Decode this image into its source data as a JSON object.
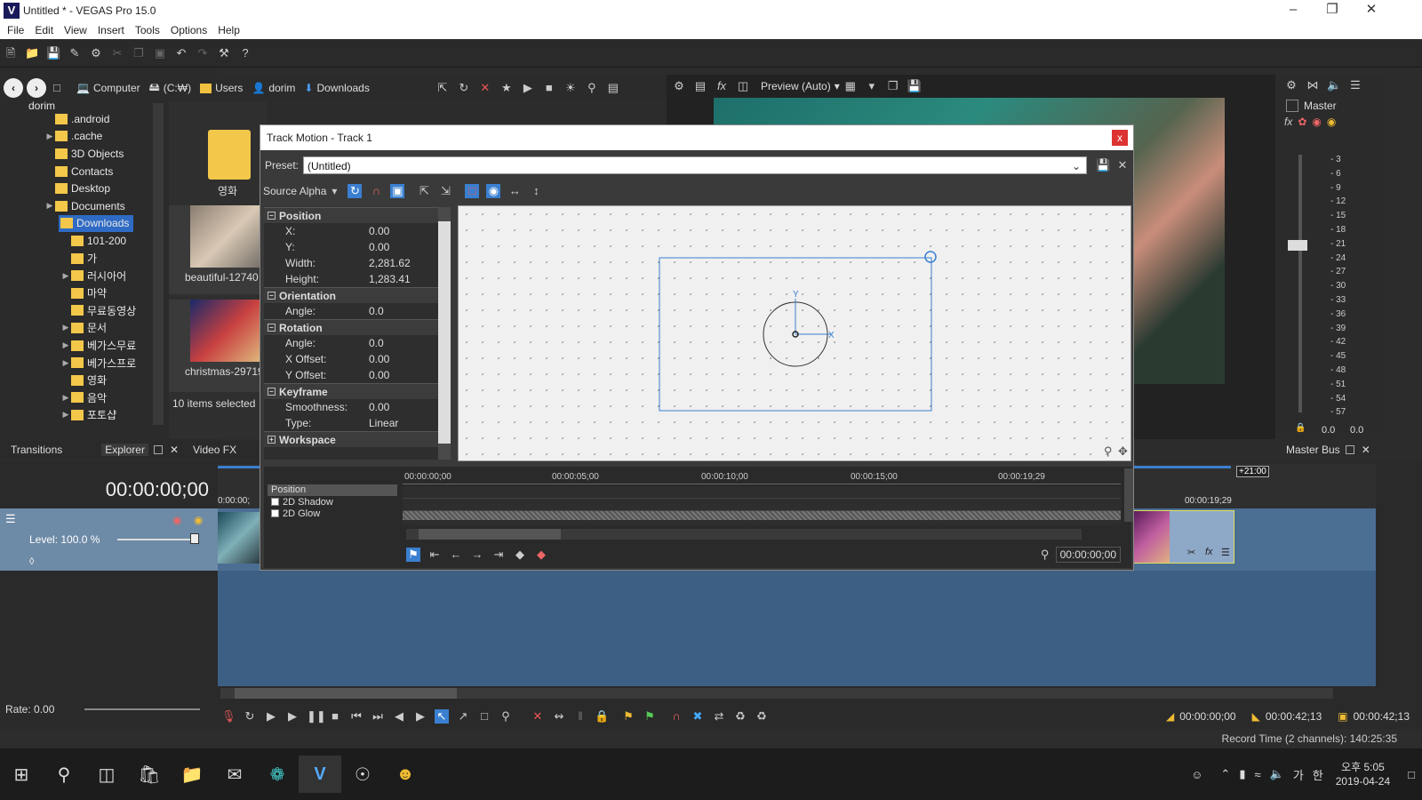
{
  "window": {
    "title": "Untitled * - VEGAS Pro 15.0",
    "logo": "V"
  },
  "menu": [
    "File",
    "Edit",
    "View",
    "Insert",
    "Tools",
    "Options",
    "Help"
  ],
  "nav": {
    "crumbs": [
      "Computer",
      "(C:₩)",
      "Users",
      "dorim",
      "Downloads"
    ]
  },
  "tree": {
    "root": "dorim",
    "items": [
      {
        "label": ".android",
        "arrow": ""
      },
      {
        "label": ".cache",
        "arrow": "▶"
      },
      {
        "label": "3D Objects",
        "arrow": ""
      },
      {
        "label": "Contacts",
        "arrow": ""
      },
      {
        "label": "Desktop",
        "arrow": ""
      },
      {
        "label": "Documents",
        "arrow": "▶"
      },
      {
        "label": "Downloads",
        "arrow": "▼",
        "selected": true
      },
      {
        "label": "101-200",
        "arrow": "",
        "indent": true
      },
      {
        "label": "가",
        "arrow": "",
        "indent": true
      },
      {
        "label": "러시아어",
        "arrow": "▶",
        "indent": true
      },
      {
        "label": "마약",
        "arrow": "",
        "indent": true
      },
      {
        "label": "무료동영상",
        "arrow": "",
        "indent": true
      },
      {
        "label": "문서",
        "arrow": "▶",
        "indent": true
      },
      {
        "label": "베가스무료",
        "arrow": "▶",
        "indent": true
      },
      {
        "label": "베가스프로",
        "arrow": "▶",
        "indent": true
      },
      {
        "label": "영화",
        "arrow": "",
        "indent": true
      },
      {
        "label": "음악",
        "arrow": "▶",
        "indent": true
      },
      {
        "label": "포토샵",
        "arrow": "▶",
        "indent": true
      }
    ]
  },
  "files": {
    "folder_label": "영화",
    "item1": "beautiful-12740",
    "item2": "christmas-29719",
    "selected": "10 items selected"
  },
  "tabs": {
    "transitions": "Transitions",
    "explorer": "Explorer",
    "videofx": "Video FX",
    "masterbus": "Master Bus"
  },
  "preview": {
    "mode": "Preview (Auto)"
  },
  "master": {
    "label": "Master",
    "db": [
      "3",
      "6",
      "9",
      "12",
      "15",
      "18",
      "21",
      "24",
      "27",
      "30",
      "33",
      "36",
      "39",
      "42",
      "45",
      "48",
      "51",
      "54",
      "57"
    ],
    "left": "0.0",
    "right": "0.0"
  },
  "dialog": {
    "title": "Track Motion - Track 1",
    "close": "x",
    "preset_label": "Preset:",
    "preset_value": "(Untitled)",
    "source_alpha": "Source Alpha",
    "sections": {
      "position": "Position",
      "orientation": "Orientation",
      "rotation": "Rotation",
      "keyframe": "Keyframe",
      "workspace": "Workspace"
    },
    "props": {
      "x_label": "X:",
      "x": "0.00",
      "y_label": "Y:",
      "y": "0.00",
      "w_label": "Width:",
      "w": "2,281.62",
      "h_label": "Height:",
      "h": "1,283.41",
      "o_angle_label": "Angle:",
      "o_angle": "0.0",
      "r_angle_label": "Angle:",
      "r_angle": "0.0",
      "xo_label": "X Offset:",
      "xo": "0.00",
      "yo_label": "Y Offset:",
      "yo": "0.00",
      "smooth_label": "Smoothness:",
      "smooth": "0.00",
      "type_label": "Type:",
      "type": "Linear"
    },
    "axis_y": "Y",
    "axis_x": "X",
    "kf_rows": [
      "Position",
      "2D Shadow",
      "2D Glow"
    ],
    "kf_ticks": [
      "00:00:00;00",
      "00:00:05;00",
      "00:00:10;00",
      "00:00:15;00",
      "00:00:19;29"
    ],
    "kf_time": "00:00:00;00"
  },
  "timeline": {
    "time": "00:00:00;00",
    "level": "Level: 100.0 %",
    "ruler_start": "0:00:00;",
    "ruler_end": "00:00:19;29",
    "marker": "+21:00",
    "rate": "Rate: 0.00",
    "sel_start": "00:00:00;00",
    "sel_end": "00:00:42;13",
    "sel_len": "00:00:42;13"
  },
  "status": {
    "record": "Record Time (2 channels): 140:25:35"
  },
  "taskbar": {
    "ime": "가",
    "ime2": "한",
    "time": "오후 5:05",
    "date": "2019-04-24"
  }
}
